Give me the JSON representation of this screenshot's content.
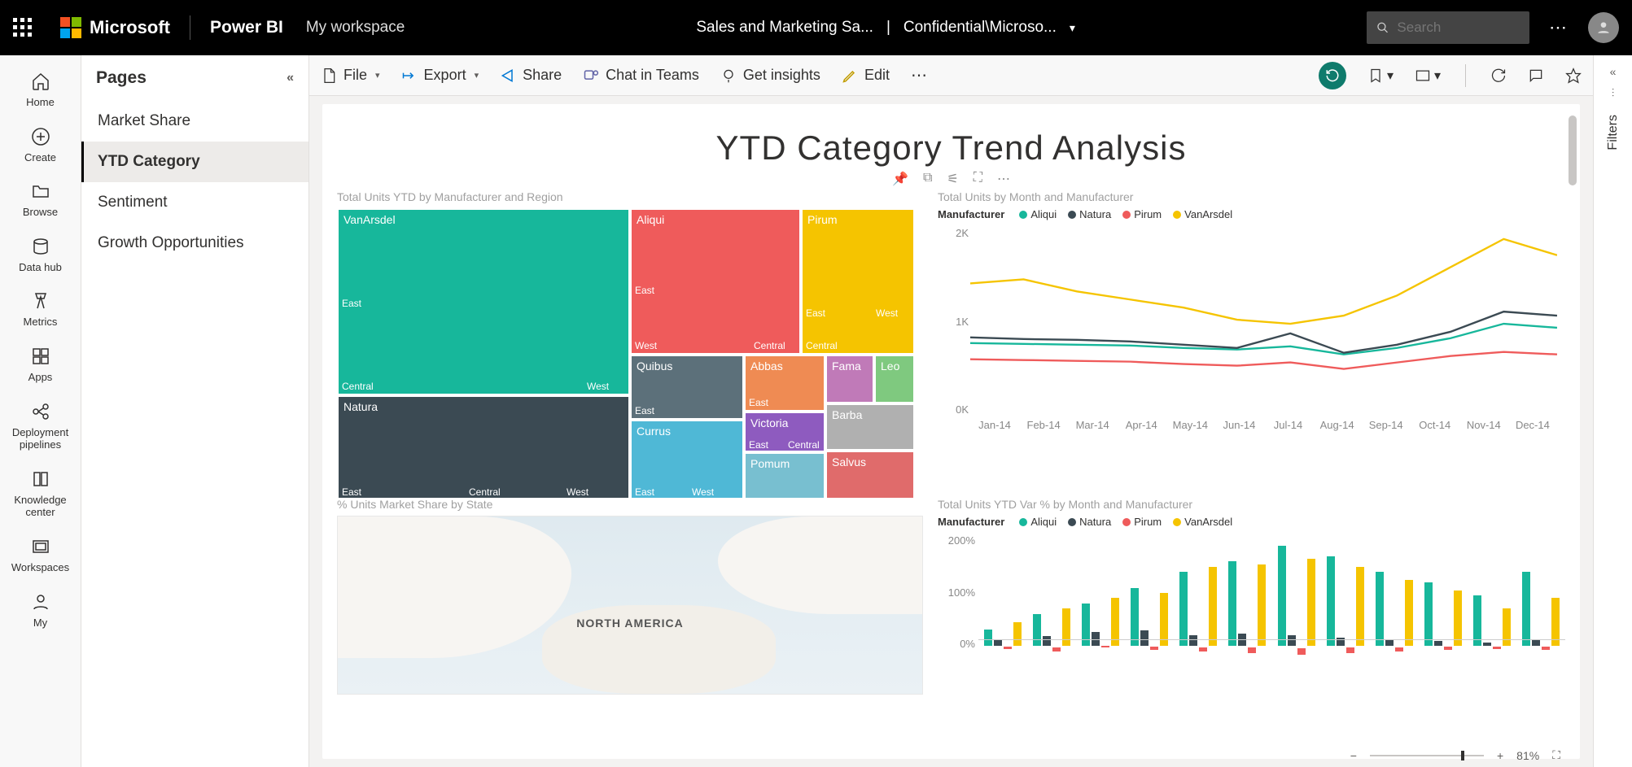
{
  "top": {
    "microsoft": "Microsoft",
    "powerbi": "Power BI",
    "workspace": "My workspace",
    "report_name": "Sales and Marketing Sa...",
    "sensitivity": "Confidential\\Microso...",
    "search_placeholder": "Search"
  },
  "rail": {
    "home": "Home",
    "create": "Create",
    "browse": "Browse",
    "datahub": "Data hub",
    "metrics": "Metrics",
    "apps": "Apps",
    "pipelines": "Deployment pipelines",
    "knowledge": "Knowledge center",
    "workspaces": "Workspaces",
    "my": "My"
  },
  "pages": {
    "heading": "Pages",
    "items": [
      "Market Share",
      "YTD Category",
      "Sentiment",
      "Growth Opportunities"
    ],
    "active_index": 1
  },
  "cmd": {
    "file": "File",
    "export": "Export",
    "share": "Share",
    "chat": "Chat in Teams",
    "insights": "Get insights",
    "edit": "Edit"
  },
  "report": {
    "title": "YTD Category Trend Analysis",
    "treemap_title": "Total Units YTD by Manufacturer and Region",
    "line_title": "Total Units by Month and Manufacturer",
    "map_title": "% Units Market Share by State",
    "bar_title": "Total Units YTD Var % by Month and Manufacturer",
    "legend_label": "Manufacturer",
    "map_label": "NORTH AMERICA"
  },
  "colors": {
    "Aliqui": "#17b79b",
    "Natura": "#3b4a53",
    "Pirum": "#ef5b5b",
    "VanArsdel": "#f5c400",
    "Quibus": "#5c707a",
    "Currus": "#4fb8d6",
    "Abbas": "#ef8b53",
    "Pomum": "#78bfd0",
    "Fama": "#c07ab8",
    "Leo": "#7fc97f",
    "Victoria": "#8e5bbf",
    "Barba": "#b0b0b0",
    "Salvus": "#e06b6b"
  },
  "chart_data": [
    {
      "id": "treemap",
      "type": "treemap",
      "title": "Total Units YTD by Manufacturer and Region",
      "nodes": [
        {
          "name": "VanArsdel",
          "value": 4200,
          "color": "Aliqui",
          "children": [
            {
              "name": "East",
              "value": 2400
            },
            {
              "name": "West",
              "value": 600
            },
            {
              "name": "Central",
              "value": 1200
            }
          ]
        },
        {
          "name": "Natura",
          "value": 1550,
          "color": "Natura",
          "children": [
            {
              "name": "East",
              "value": 700
            },
            {
              "name": "Central",
              "value": 500
            },
            {
              "name": "West",
              "value": 350
            }
          ]
        },
        {
          "name": "Aliqui",
          "value": 1750,
          "color": "Pirum",
          "children": [
            {
              "name": "East",
              "value": 1100
            },
            {
              "name": "West",
              "value": 420
            },
            {
              "name": "Central",
              "value": 230
            }
          ]
        },
        {
          "name": "Pirum",
          "value": 1050,
          "color": "VanArsdel",
          "children": [
            {
              "name": "East",
              "value": 560
            },
            {
              "name": "West",
              "value": 280
            },
            {
              "name": "Central",
              "value": 210
            }
          ]
        },
        {
          "name": "Quibus",
          "value": 620,
          "color": "Quibus",
          "children": [
            {
              "name": "East",
              "value": 620
            }
          ]
        },
        {
          "name": "Currus",
          "value": 500,
          "color": "Currus",
          "children": [
            {
              "name": "East",
              "value": 300
            },
            {
              "name": "West",
              "value": 200
            }
          ]
        },
        {
          "name": "Abbas",
          "value": 430,
          "color": "Abbas",
          "children": [
            {
              "name": "East",
              "value": 430
            }
          ]
        },
        {
          "name": "Victoria",
          "value": 310,
          "color": "Victoria",
          "children": [
            {
              "name": "East",
              "value": 180
            },
            {
              "name": "Central",
              "value": 130
            }
          ]
        },
        {
          "name": "Pomum",
          "value": 280,
          "color": "Pomum"
        },
        {
          "name": "Fama",
          "value": 200,
          "color": "Fama"
        },
        {
          "name": "Leo",
          "value": 180,
          "color": "Leo"
        },
        {
          "name": "Barba",
          "value": 260,
          "color": "Barba"
        },
        {
          "name": "Salvus",
          "value": 220,
          "color": "Salvus"
        }
      ]
    },
    {
      "id": "line",
      "type": "line",
      "title": "Total Units by Month and Manufacturer",
      "xlabel": "",
      "ylabel": "",
      "ylim": [
        0,
        2200
      ],
      "categories": [
        "Jan-14",
        "Feb-14",
        "Mar-14",
        "Apr-14",
        "May-14",
        "Jun-14",
        "Jul-14",
        "Aug-14",
        "Sep-14",
        "Oct-14",
        "Nov-14",
        "Dec-14"
      ],
      "y_ticks": [
        "2K",
        "1K",
        "0K"
      ],
      "series": [
        {
          "name": "Aliqui",
          "values": [
            760,
            750,
            740,
            730,
            700,
            680,
            720,
            620,
            700,
            820,
            1000,
            950
          ]
        },
        {
          "name": "Natura",
          "values": [
            830,
            810,
            800,
            780,
            740,
            700,
            880,
            640,
            740,
            900,
            1150,
            1100
          ]
        },
        {
          "name": "Pirum",
          "values": [
            560,
            550,
            540,
            530,
            500,
            480,
            520,
            440,
            520,
            600,
            650,
            620
          ]
        },
        {
          "name": "VanArsdel",
          "values": [
            1500,
            1550,
            1400,
            1300,
            1200,
            1050,
            1000,
            1100,
            1350,
            1700,
            2050,
            1850
          ]
        }
      ]
    },
    {
      "id": "bar",
      "type": "bar",
      "title": "Total Units YTD Var % by Month and Manufacturer",
      "xlabel": "",
      "ylabel": "",
      "ylim": [
        -20,
        200
      ],
      "y_ticks": [
        "200%",
        "100%",
        "0%"
      ],
      "categories": [
        "Jan-14",
        "Feb-14",
        "Mar-14",
        "Apr-14",
        "May-14",
        "Jun-14",
        "Jul-14",
        "Aug-14",
        "Sep-14",
        "Oct-14",
        "Nov-14",
        "Dec-14"
      ],
      "series": [
        {
          "name": "Aliqui",
          "values": [
            30,
            60,
            80,
            110,
            140,
            160,
            190,
            170,
            140,
            120,
            95,
            140
          ]
        },
        {
          "name": "Natura",
          "values": [
            10,
            18,
            25,
            28,
            20,
            22,
            20,
            15,
            10,
            8,
            6,
            10
          ]
        },
        {
          "name": "Pirum",
          "values": [
            -5,
            -8,
            -3,
            -6,
            -8,
            -10,
            -12,
            -10,
            -8,
            -6,
            -5,
            -6
          ]
        },
        {
          "name": "VanArsdel",
          "values": [
            45,
            70,
            90,
            100,
            150,
            155,
            165,
            150,
            125,
            105,
            70,
            90
          ]
        }
      ]
    }
  ],
  "footer": {
    "zoom": "81%"
  }
}
